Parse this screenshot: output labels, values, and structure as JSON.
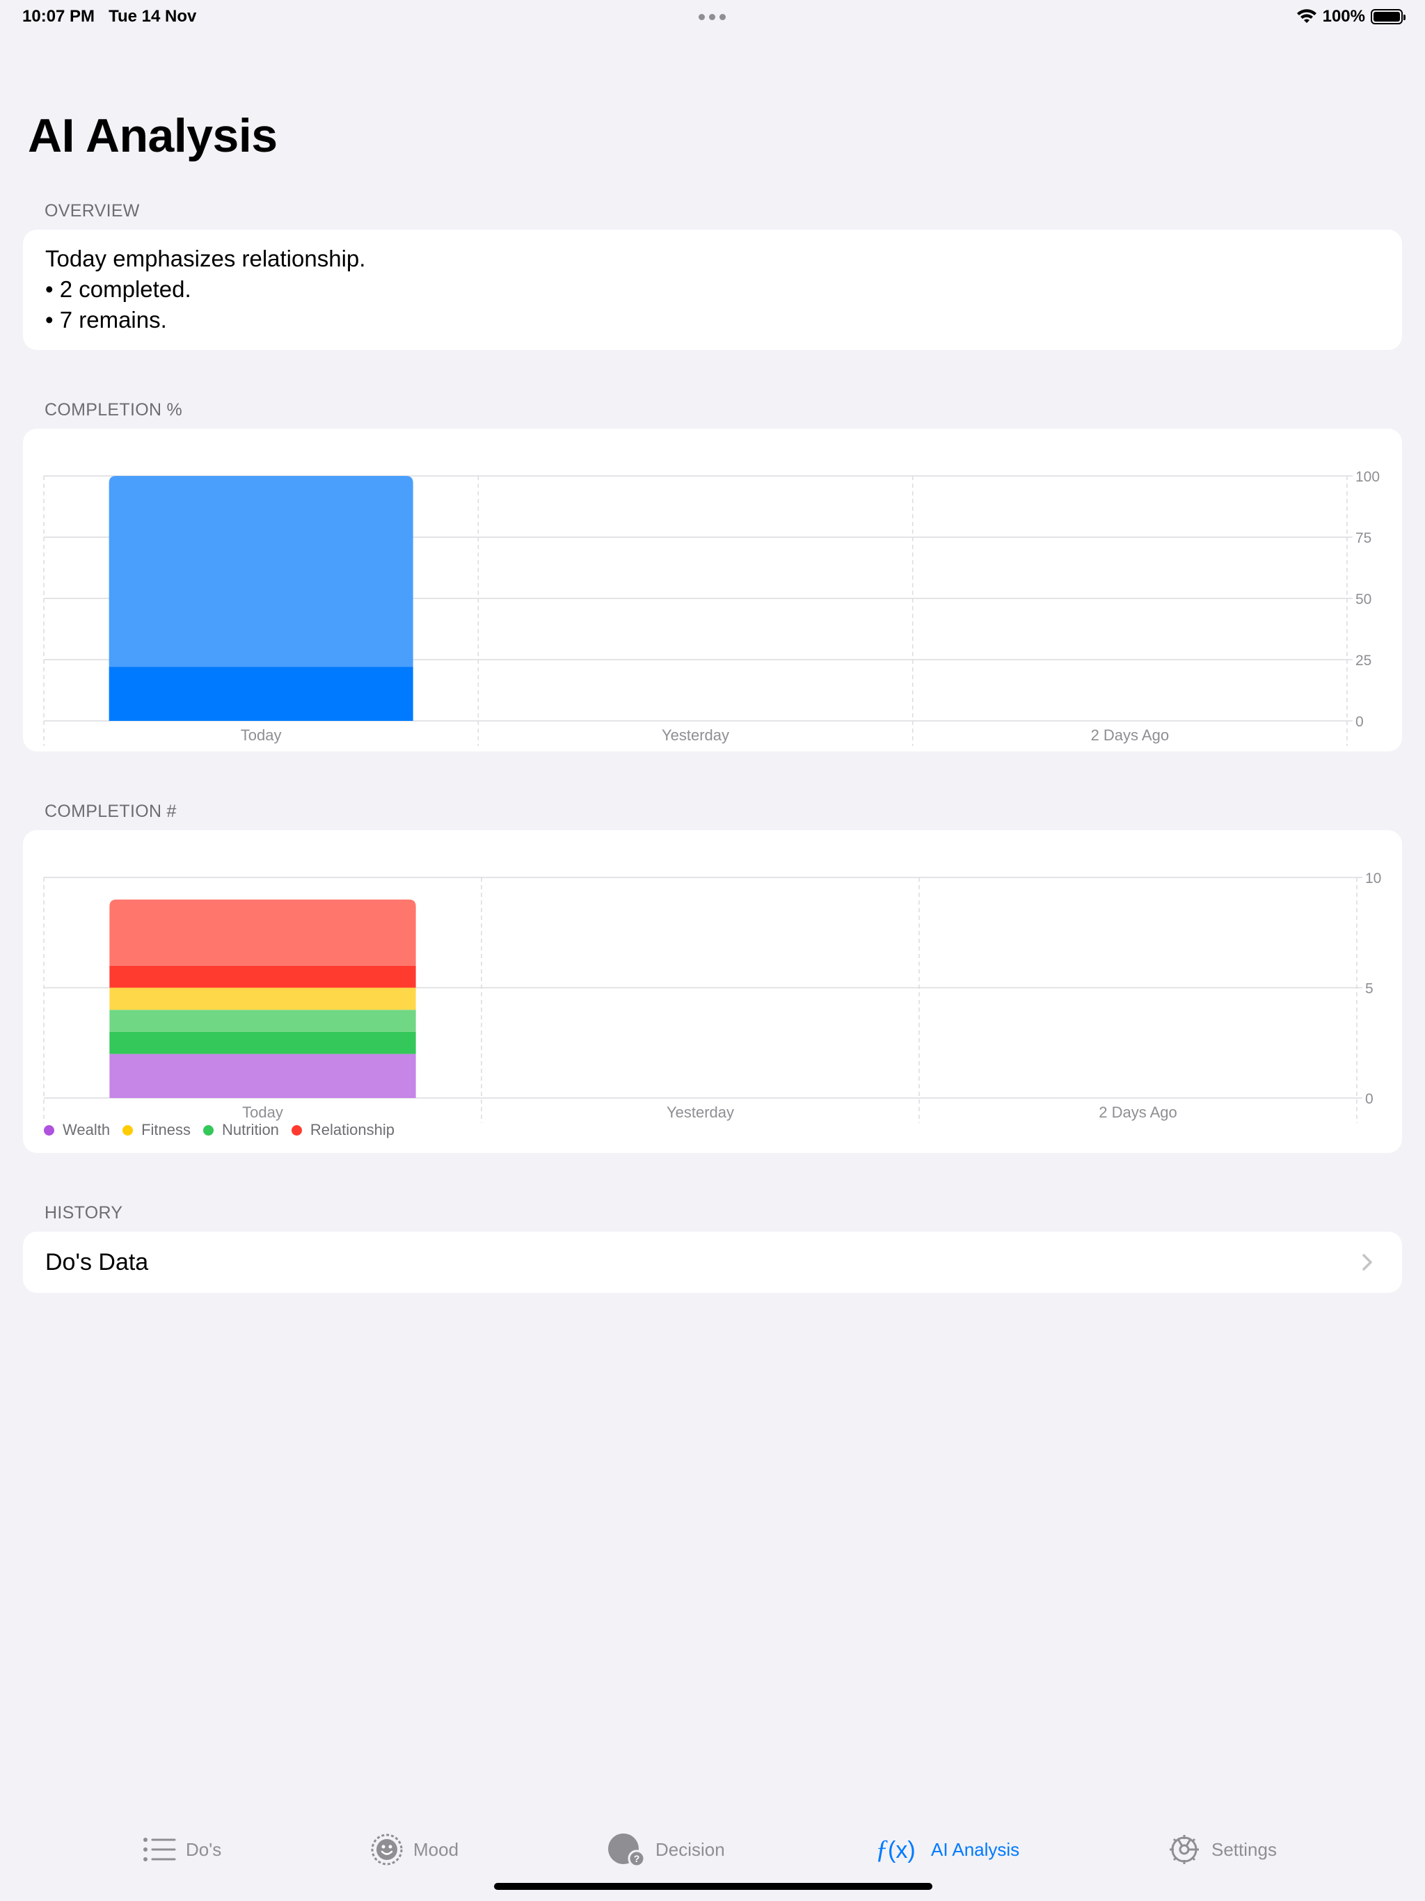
{
  "status_bar": {
    "time": "10:07 PM",
    "date": "Tue 14 Nov",
    "battery": "100%"
  },
  "title": "AI Analysis",
  "overview": {
    "header": "OVERVIEW",
    "lines": [
      "Today emphasizes relationship.",
      "• 2 completed.",
      "• 7 remains."
    ]
  },
  "completion_percent": {
    "header": "COMPLETION %"
  },
  "completion_count": {
    "header": "COMPLETION #"
  },
  "history": {
    "header": "HISTORY",
    "row_label": "Do's Data"
  },
  "tabs": [
    {
      "label": "Do's",
      "icon": "list-icon",
      "active": false
    },
    {
      "label": "Mood",
      "icon": "smiley-icon",
      "active": false
    },
    {
      "label": "Decision",
      "icon": "decision-icon",
      "active": false
    },
    {
      "label": "AI Analysis",
      "icon": "function-icon",
      "active": true
    },
    {
      "label": "Settings",
      "icon": "gear-icon",
      "active": false
    }
  ],
  "colors": {
    "accent": "#007aff",
    "background": "#f2f2f7"
  },
  "chart_data": [
    {
      "type": "bar",
      "stacked": true,
      "categories": [
        "Today",
        "Yesterday",
        "2 Days Ago"
      ],
      "ylim": [
        0,
        100
      ],
      "yticks": [
        0,
        25,
        50,
        75,
        100
      ],
      "series": [
        {
          "values": [
            22,
            0,
            0
          ],
          "color": "#007aff"
        },
        {
          "values": [
            78,
            0,
            0
          ],
          "color": "#4a9ffd"
        }
      ],
      "grid": true
    },
    {
      "type": "bar",
      "stacked": true,
      "categories": [
        "Today",
        "Yesterday",
        "2 Days Ago"
      ],
      "ylim": [
        0,
        10
      ],
      "yticks": [
        0,
        5,
        10
      ],
      "series": [
        {
          "name": "Wealth",
          "values": [
            2,
            0,
            0
          ],
          "color": "#c586e8"
        },
        {
          "values": [
            1,
            0,
            0
          ],
          "color": "#34c759"
        },
        {
          "values": [
            1,
            0,
            0
          ],
          "color": "#70d785"
        },
        {
          "values": [
            1,
            0,
            0
          ],
          "color": "#ffd84a"
        },
        {
          "values": [
            1,
            0,
            0
          ],
          "color": "#ff3b30"
        },
        {
          "values": [
            3,
            0,
            0
          ],
          "color": "#ff766d"
        }
      ],
      "legend": [
        {
          "name": "Wealth",
          "color": "#af52de"
        },
        {
          "name": "Fitness",
          "color": "#ffcc00"
        },
        {
          "name": "Nutrition",
          "color": "#34c759"
        },
        {
          "name": "Relationship",
          "color": "#ff3b30"
        }
      ],
      "legend_position": "bottom-left",
      "grid": true
    }
  ]
}
